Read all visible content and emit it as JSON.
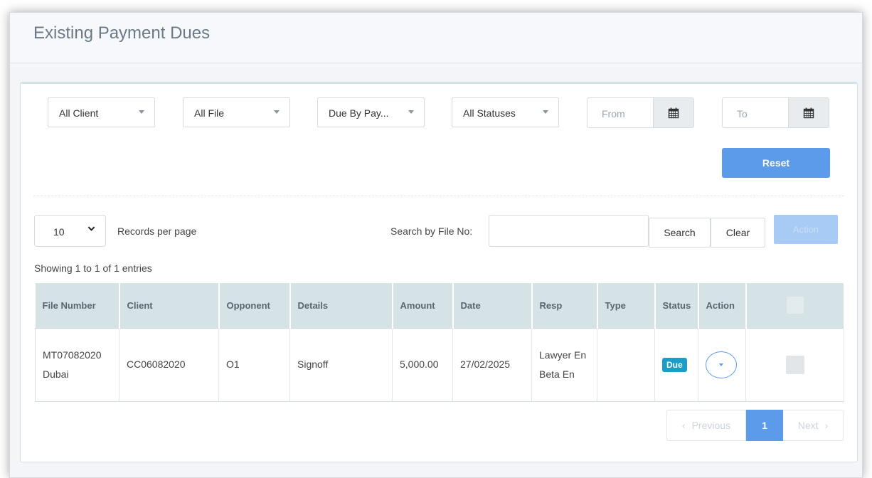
{
  "header": {
    "title": "Existing Payment Dues"
  },
  "filters": {
    "client": "All Client",
    "file": "All File",
    "due_by": "Due By Pay...",
    "status": "All Statuses",
    "from_placeholder": "From",
    "to_placeholder": "To",
    "reset_label": "Reset"
  },
  "toolbar": {
    "page_length": "10",
    "records_per_page": "Records per page",
    "search_label": "Search by File No:",
    "search_value": "",
    "search_button": "Search",
    "clear_button": "Clear",
    "action_button": "Action"
  },
  "info": {
    "showing": "Showing 1 to 1 of 1 entries"
  },
  "table": {
    "columns": [
      "File Number",
      "Client",
      "Opponent",
      "Details",
      "Amount",
      "Date",
      "Resp",
      "Type",
      "Status",
      "Action"
    ],
    "rows": [
      {
        "file_number": "MT07082020 Dubai",
        "client": "CC06082020",
        "opponent": "O1",
        "details": "Signoff",
        "amount": "5,000.00",
        "date": "27/02/2025",
        "resp": "Lawyer En Beta En",
        "type": "",
        "status": "Due"
      }
    ]
  },
  "pagination": {
    "previous": "Previous",
    "current": "1",
    "next": "Next"
  },
  "colors": {
    "primary": "#5b9bea",
    "badge": "#1a9ec9",
    "table_header": "#d5e3e7"
  }
}
